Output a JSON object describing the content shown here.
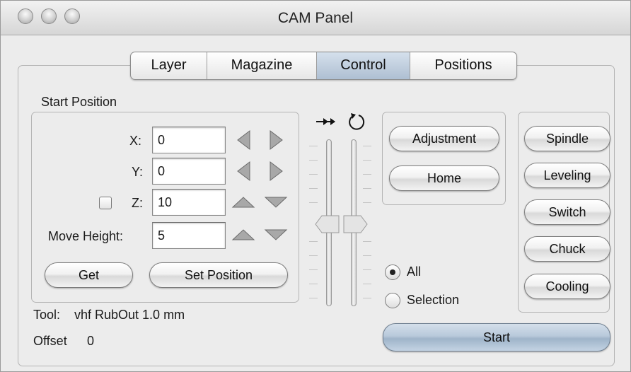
{
  "window": {
    "title": "CAM Panel"
  },
  "tabs": [
    {
      "label": "Layer",
      "active": false
    },
    {
      "label": "Magazine",
      "active": false
    },
    {
      "label": "Control",
      "active": true
    },
    {
      "label": "Positions",
      "active": false
    }
  ],
  "start_position": {
    "title": "Start Position",
    "x_label": "X:",
    "x_value": "0",
    "y_label": "Y:",
    "y_value": "0",
    "z_label": "Z:",
    "z_value": "10",
    "z_checked": false,
    "move_height_label": "Move Height:",
    "move_height_value": "5",
    "get_label": "Get",
    "set_position_label": "Set Position"
  },
  "tool": {
    "label": "Tool:",
    "value": "vhf RubOut 1.0 mm"
  },
  "offset": {
    "label": "Offset",
    "value": "0"
  },
  "sliders": {
    "feed_icon": "double-arrow-right-icon",
    "speed_icon": "rotation-icon"
  },
  "actions": {
    "adjustment_label": "Adjustment",
    "home_label": "Home"
  },
  "scope": {
    "all_label": "All",
    "selection_label": "Selection",
    "selected": "All"
  },
  "start_label": "Start",
  "side_buttons": [
    "Spindle",
    "Leveling",
    "Switch",
    "Chuck",
    "Cooling"
  ],
  "colors": {
    "active_tab": "#aebfd2",
    "start_button": "#b8c9db"
  }
}
